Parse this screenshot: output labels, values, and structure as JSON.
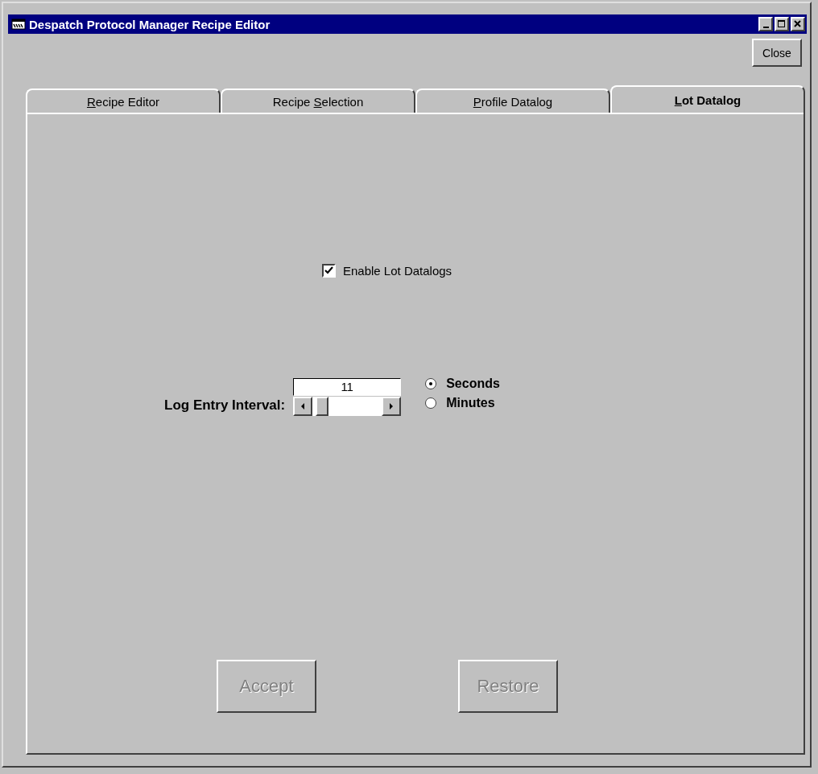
{
  "window": {
    "title": "Despatch Protocol Manager Recipe Editor"
  },
  "close_button": {
    "label": "Close"
  },
  "tabs": [
    {
      "mnemonic": "R",
      "label_after": "ecipe Editor",
      "selected": false
    },
    {
      "label_before": "Recipe ",
      "mnemonic": "S",
      "label_after": "election",
      "selected": false
    },
    {
      "mnemonic": "P",
      "label_after": "rofile Datalog",
      "selected": false
    },
    {
      "mnemonic": "L",
      "label_after": "ot Datalog",
      "selected": true
    }
  ],
  "enable_checkbox": {
    "label": "Enable Lot Datalogs",
    "checked": true
  },
  "interval": {
    "label": "Log Entry Interval:",
    "value": "11",
    "level": 0.05
  },
  "units": [
    {
      "label": "Seconds",
      "selected": true
    },
    {
      "label": "Minutes",
      "selected": false
    }
  ],
  "buttons": [
    {
      "label": "Accept",
      "disabled": true
    },
    {
      "label": "Restore",
      "disabled": true
    }
  ]
}
